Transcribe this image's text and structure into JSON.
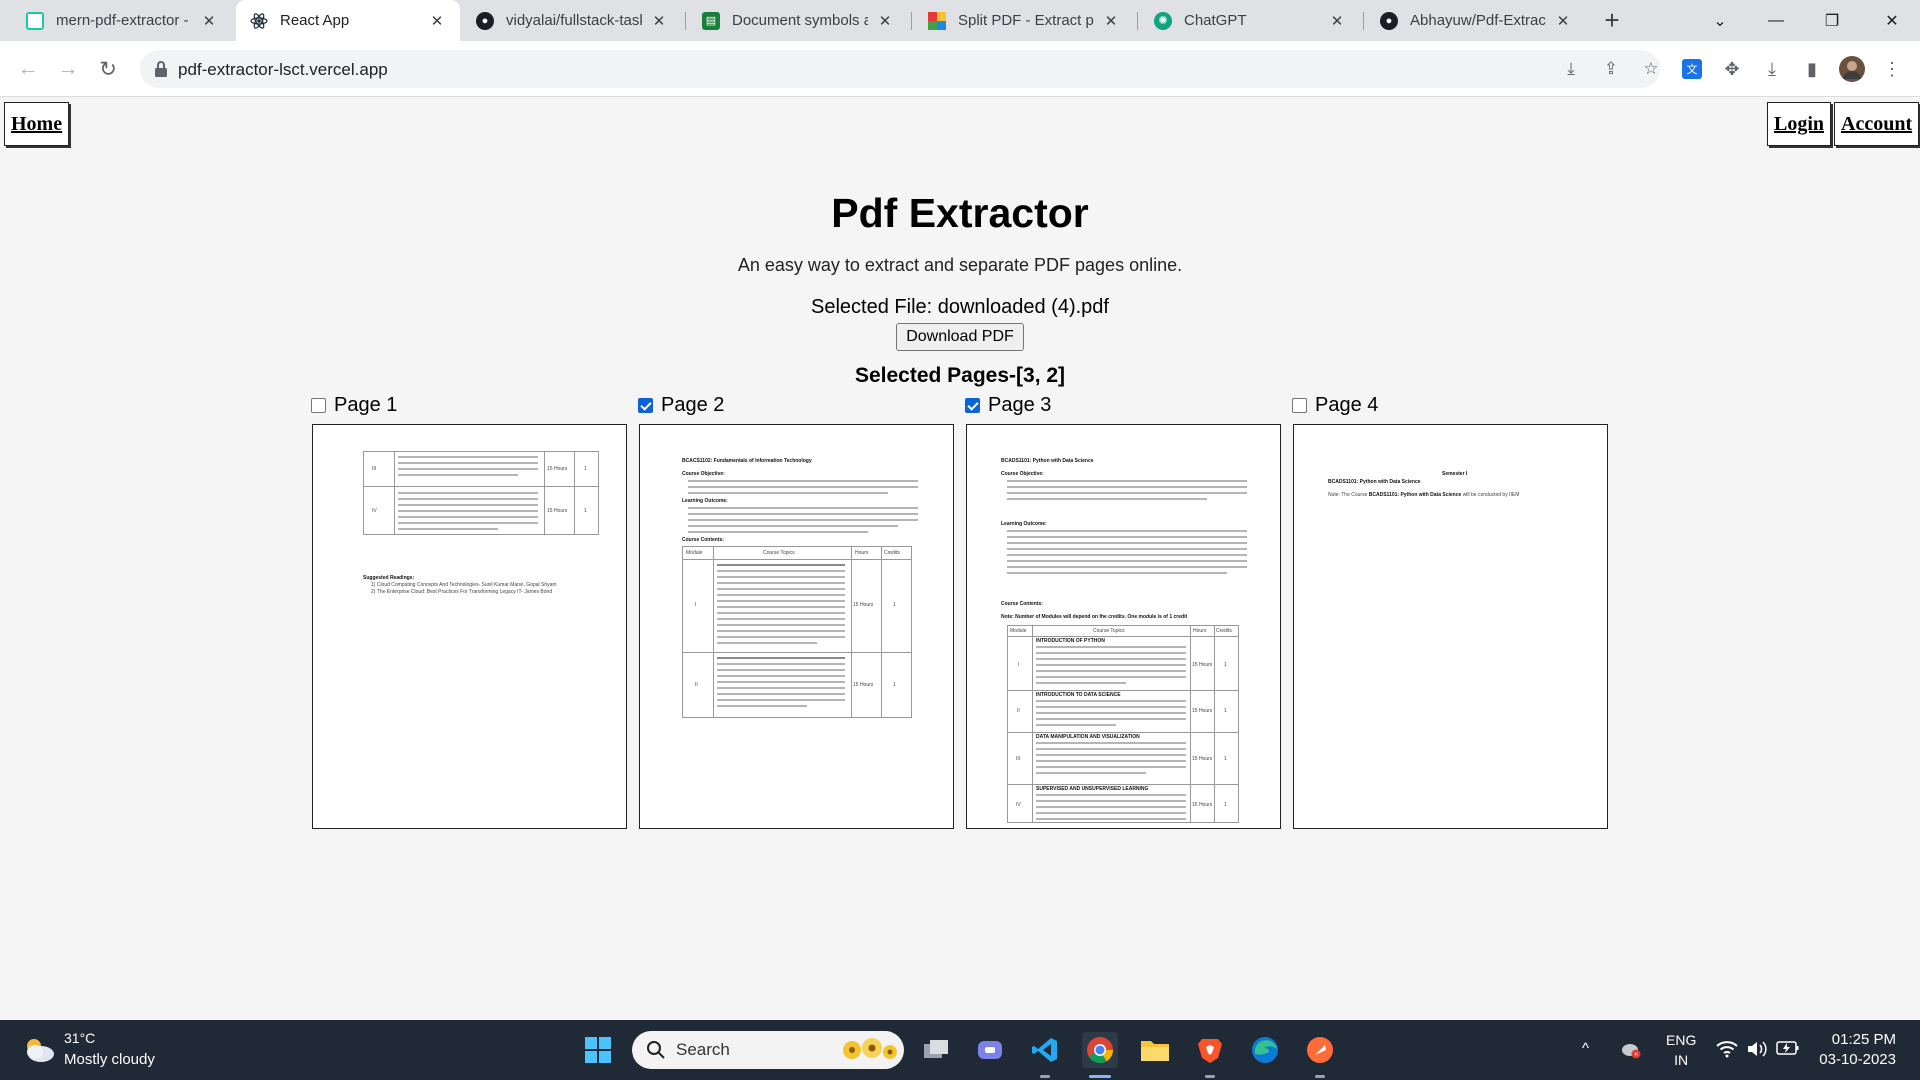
{
  "browser": {
    "tabs": [
      {
        "title": "mern-pdf-extractor -",
        "icon": "vercel-icon",
        "active": false
      },
      {
        "title": "React App",
        "icon": "react-icon",
        "active": true
      },
      {
        "title": "vidyalai/fullstack-task",
        "icon": "github-icon",
        "active": false
      },
      {
        "title": "Document symbols a",
        "icon": "docs-icon",
        "active": false
      },
      {
        "title": "Split PDF - Extract pa",
        "icon": "ilovepdf-icon",
        "active": false
      },
      {
        "title": "ChatGPT",
        "icon": "chatgpt-icon",
        "active": false
      },
      {
        "title": "Abhayuw/Pdf-Extract",
        "icon": "github-icon",
        "active": false
      }
    ],
    "url": "pdf-extractor-lsct.vercel.app"
  },
  "page": {
    "nav": {
      "home": "Home",
      "login": "Login",
      "account": "Account"
    },
    "title": "Pdf Extractor",
    "subtitle": "An easy way to extract and separate PDF pages online.",
    "selected_file": "Selected File: downloaded (4).pdf",
    "download_button": "Download PDF",
    "selected_pages": "Selected Pages-[3, 2]",
    "pages": [
      {
        "label": "Page 1",
        "checked": false
      },
      {
        "label": "Page 2",
        "checked": true
      },
      {
        "label": "Page 3",
        "checked": true
      },
      {
        "label": "Page 4",
        "checked": false
      }
    ],
    "thumbnails": {
      "p1": {
        "rows": [
          "III",
          "IV"
        ],
        "hours": [
          "15 Hours",
          "15 Hours"
        ],
        "credits": [
          "1",
          "1"
        ],
        "readings_title": "Suggested Readings:",
        "readings": [
          "1) Cloud Computing Concepts And Technologies- Sunil Kumar Manvi, Gopal Shyam",
          "2) The Enterprise Cloud: Best Practices For Transforming Legacy IT- James Bond"
        ]
      },
      "p2": {
        "heading": "BCACS1102: Fundamentals of Information Technology",
        "objective": "Course Objective:",
        "outcome": "Learning Outcome:",
        "contents": "Course Contents:",
        "cols": [
          "Module",
          "Course Topics",
          "Hours",
          "Credits"
        ],
        "rows": [
          "I",
          "II"
        ],
        "hours": [
          "15 Hours",
          "15 Hours"
        ],
        "credits": [
          "1",
          "1"
        ]
      },
      "p3": {
        "heading": "BCADS1101: Python with Data Science",
        "objective": "Course Objective:",
        "outcome": "Learning Outcome:",
        "contents": "Course Contents:",
        "note": "Note: Number of Modules will depend on the credits. One module is of 1 credit",
        "cols": [
          "Module",
          "Course Topics",
          "Hours",
          "Credits"
        ],
        "rows": [
          "I",
          "II",
          "III",
          "IV"
        ],
        "topics": [
          "INTRODUCTION OF PYTHON",
          "INTRODUCTION TO DATA SCIENCE",
          "DATA MANIPULATION AND VISUALIZATION",
          "SUPERVISED AND UNSUPERVISED LEARNING"
        ],
        "hours": [
          "15 Hours",
          "15 Hours",
          "15 Hours",
          "15 Hours"
        ],
        "credits": [
          "1",
          "1",
          "1",
          "1"
        ]
      },
      "p4": {
        "heading": "Semester I",
        "course": "BCADS1101: Python with Data Science",
        "note_prefix": "Note: The Course",
        "note_course": "BCADS1101: Python with Data Science",
        "note_suffix": "will be conducted by IIEM"
      }
    }
  },
  "taskbar": {
    "weather_temp": "31°C",
    "weather_desc": "Mostly cloudy",
    "search_label": "Search",
    "lang_1": "ENG",
    "lang_2": "IN",
    "time": "01:25 PM",
    "date": "03-10-2023"
  }
}
